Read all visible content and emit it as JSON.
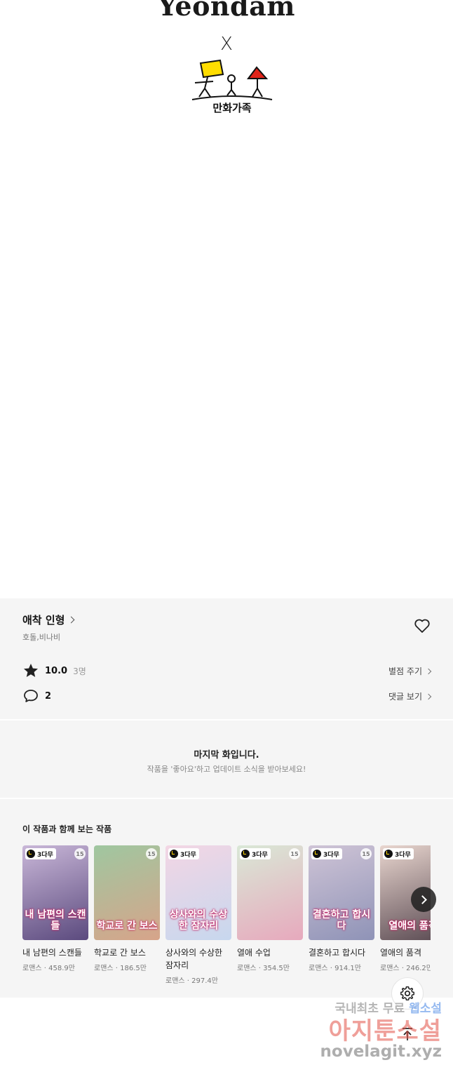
{
  "credits": {
    "brand": "Yeondam",
    "cross": "X",
    "partner_logo_text": "만화가족"
  },
  "work": {
    "title": "애착 인형",
    "authors": "호돌,비나비",
    "rating": "10.0",
    "rating_count": "3명",
    "rate_link": "별점 주기",
    "comments": "2",
    "comments_link": "댓글 보기"
  },
  "last_episode": {
    "title": "마지막 화입니다.",
    "subtitle": "작품을 '좋아요'하고 업데이트 소식을 받아보세요!"
  },
  "recommend": {
    "heading": "이 작품과 함께 보는 작품",
    "items": [
      {
        "name": "내 남편의 스캔들",
        "meta": "로맨스 · 458.9만",
        "free": "3다무",
        "age": "15",
        "art": "내 남편의 스캔들",
        "color1": "#c9b7d8",
        "color2": "#5b4a7e"
      },
      {
        "name": "학교로 간 보스",
        "meta": "로맨스 · 186.5만",
        "free": "",
        "age": "15",
        "art": "학교로 간 보스",
        "color1": "#9fc7a0",
        "color2": "#d7a48a"
      },
      {
        "name": "상사와의 수상한 잠자리",
        "meta": "로맨스 · 297.4만",
        "free": "3다무",
        "age": "",
        "art": "상사와의 수상한 잠자리",
        "color1": "#f3d6e4",
        "color2": "#c7d7ee"
      },
      {
        "name": "열애 수업",
        "meta": "로맨스 · 354.5만",
        "free": "3다무",
        "age": "15",
        "art": "",
        "color1": "#d9e8d6",
        "color2": "#e7a9bd"
      },
      {
        "name": "결혼하고 합시다",
        "meta": "로맨스 · 914.1만",
        "free": "3다무",
        "age": "15",
        "art": "결혼하고 합시다",
        "color1": "#cfc4d6",
        "color2": "#8f93b7"
      },
      {
        "name": "열애의 품격",
        "meta": "로맨스 · 246.2만",
        "free": "3다무",
        "age": "",
        "art": "열애의 품격",
        "color1": "#e9d6cf",
        "color2": "#5a4a52"
      }
    ]
  },
  "watermark": {
    "line1_a": "국내최초 무료 ",
    "line1_b": "웹소설",
    "line2": "아지툰소설",
    "line3": "novelagit.xyz"
  },
  "colors": {
    "panel_bg": "#f5f5f5",
    "free_badge": "#ffd400"
  }
}
